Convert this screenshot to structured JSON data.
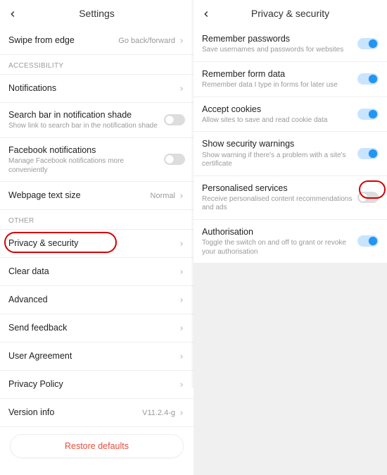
{
  "left": {
    "title": "Settings",
    "rows": [
      {
        "label": "Swipe from edge",
        "value": "Go back/forward",
        "chev": true
      },
      {
        "section": "ACCESSIBILITY"
      },
      {
        "label": "Notifications",
        "chev": true
      },
      {
        "label": "Search bar in notification shade",
        "sub": "Show link to search bar in the notification shade",
        "toggle": false
      },
      {
        "label": "Facebook notifications",
        "sub": "Manage Facebook notifications more conveniently",
        "toggle": false
      },
      {
        "label": "Webpage text size",
        "value": "Normal",
        "chev": true
      },
      {
        "section": "OTHER"
      },
      {
        "label": "Privacy & security",
        "chev": true,
        "highlight": true
      },
      {
        "label": "Clear data",
        "chev": true
      },
      {
        "label": "Advanced",
        "chev": true
      },
      {
        "label": "Send feedback",
        "chev": true
      },
      {
        "label": "User Agreement",
        "chev": true
      },
      {
        "label": "Privacy Policy",
        "chev": true
      },
      {
        "label": "Version info",
        "value": "V11.2.4-g",
        "chev": true
      }
    ],
    "restore": "Restore defaults"
  },
  "right": {
    "title": "Privacy & security",
    "rows": [
      {
        "label": "Remember passwords",
        "sub": "Save usernames and passwords for websites",
        "toggle": true
      },
      {
        "label": "Remember form data",
        "sub": "Remember data I type in forms for later use",
        "toggle": true
      },
      {
        "label": "Accept cookies",
        "sub": "Allow sites to save and read cookie data",
        "toggle": true
      },
      {
        "label": "Show security warnings",
        "sub": "Show warning if there's a problem with a site's certificate",
        "toggle": true
      },
      {
        "label": "Personalised services",
        "sub": "Receive personalised content recommendations and ads",
        "toggle": false,
        "highlight": true
      },
      {
        "label": "Authorisation",
        "sub": "Toggle the switch on and off to grant or revoke your authorisation",
        "toggle": true
      }
    ]
  }
}
